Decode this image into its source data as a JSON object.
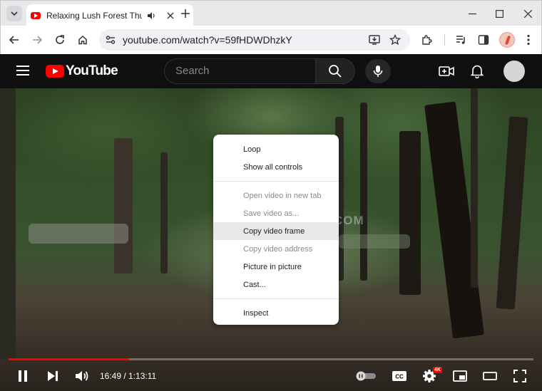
{
  "browser": {
    "tab_title": "Relaxing Lush Forest Thunderstorm",
    "url": "youtube.com/watch?v=59fHDWDhzkY"
  },
  "youtube": {
    "logo_text": "YouTube",
    "search_placeholder": "Search"
  },
  "video": {
    "watermark": "COMPUTERWD.COM"
  },
  "context_menu": {
    "groups": [
      [
        {
          "label": "Loop",
          "enabled": true
        },
        {
          "label": "Show all controls",
          "enabled": true
        }
      ],
      [
        {
          "label": "Open video in new tab",
          "enabled": false
        },
        {
          "label": "Save video as...",
          "enabled": false
        },
        {
          "label": "Copy video frame",
          "enabled": true,
          "highlighted": true
        },
        {
          "label": "Copy video address",
          "enabled": false
        },
        {
          "label": "Picture in picture",
          "enabled": true
        },
        {
          "label": "Cast...",
          "enabled": true
        }
      ],
      [
        {
          "label": "Inspect",
          "enabled": true
        }
      ]
    ]
  },
  "player": {
    "time": "16:49 / 1:13:11",
    "progress": 0.23,
    "quality_badge": "4K"
  },
  "colors": {
    "accent": "#ff0000",
    "yt_bg": "#0f0f0f"
  }
}
